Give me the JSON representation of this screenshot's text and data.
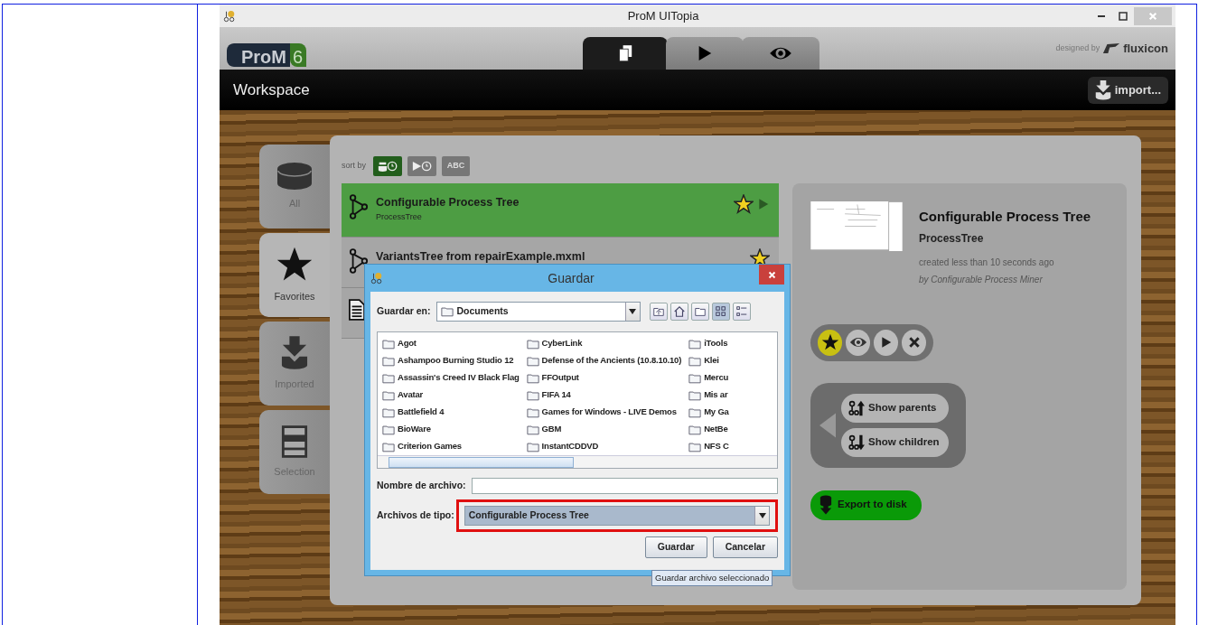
{
  "window": {
    "title": "ProM UITopia"
  },
  "header": {
    "logo": "ProM",
    "logo_version": "6",
    "credit": "designed by",
    "brand": "fluxicon",
    "tabs": [
      {
        "kind": "pages",
        "selected": true
      },
      {
        "kind": "play",
        "selected": false
      },
      {
        "kind": "eye",
        "selected": false
      }
    ]
  },
  "toolbar": {
    "title": "Workspace",
    "import_button": "import..."
  },
  "side_tabs": [
    {
      "kind": "database",
      "label": "All",
      "selected": false
    },
    {
      "kind": "star",
      "label": "Favorites",
      "selected": true
    },
    {
      "kind": "import",
      "label": "Imported",
      "selected": false
    },
    {
      "kind": "selection",
      "label": "Selection",
      "selected": false
    }
  ],
  "sort": {
    "label": "sort by",
    "options": [
      {
        "kind": "imported-time",
        "selected": true
      },
      {
        "kind": "played-time",
        "selected": false
      },
      {
        "kind": "text",
        "label": "ABC",
        "selected": false
      }
    ]
  },
  "objects": [
    {
      "kind": "tree",
      "name": "Configurable Process Tree",
      "type": "ProcessTree",
      "favorite": true,
      "selected": true
    },
    {
      "kind": "tree",
      "name": "VariantsTree from repairExample.mxml",
      "favorite": true,
      "selected": false
    },
    {
      "kind": "document",
      "selected": false
    }
  ],
  "details": {
    "title": "Configurable Process Tree",
    "type": "ProcessTree",
    "created": "created less than 10 seconds ago",
    "author": "by Configurable Process Miner",
    "actions": [
      {
        "kind": "star",
        "on": true
      },
      {
        "kind": "eye",
        "on": false
      },
      {
        "kind": "play",
        "on": false
      },
      {
        "kind": "remove",
        "on": false
      }
    ],
    "show_parents": "Show parents",
    "show_children": "Show children",
    "export": "Export to disk"
  },
  "dialog": {
    "title": "Guardar",
    "look_in_label": "Guardar en:",
    "look_in": "Documents",
    "tools": [
      {
        "kind": "up",
        "selected": false
      },
      {
        "kind": "home",
        "selected": false
      },
      {
        "kind": "new-folder",
        "selected": false
      },
      {
        "kind": "list",
        "selected": true
      },
      {
        "kind": "details",
        "selected": false
      }
    ],
    "files": [
      "Agot",
      "Ashampoo Burning Studio 12",
      "Assassin's Creed IV Black Flag",
      "Avatar",
      "Battlefield 4",
      "BioWare",
      "Criterion Games",
      "CyberLink",
      "Defense of the Ancients (10.8.10.10)",
      "FFOutput",
      "FIFA 14",
      "Games for Windows - LIVE Demos",
      "GBM",
      "InstantCDDVD",
      "iTools",
      "Klei",
      "Mercu",
      "Mis ar",
      "My Ga",
      "NetBe",
      "NFS C"
    ],
    "file_name_label": "Nombre de archivo:",
    "file_type_label": "Archivos de tipo:",
    "file_type": "Configurable Process Tree",
    "file_type_highlighted": true,
    "buttons": [
      "Guardar",
      "Cancelar"
    ],
    "tooltip": "Guardar archivo seleccionado"
  }
}
